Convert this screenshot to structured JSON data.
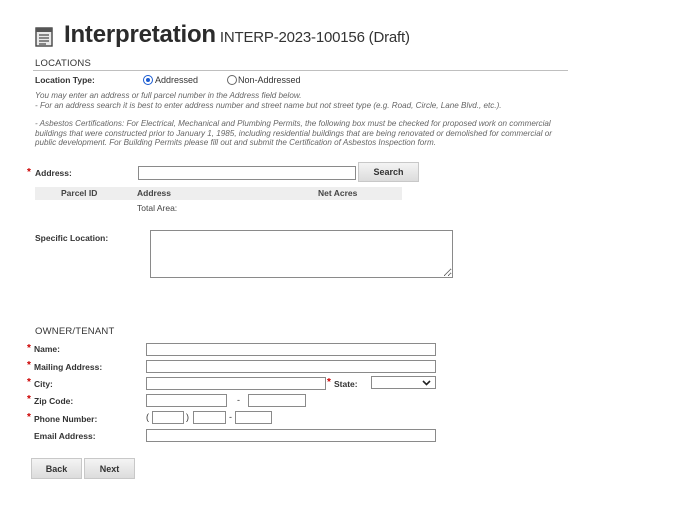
{
  "header": {
    "title": "Interpretation",
    "record": "INTERP-2023-100156 (Draft)"
  },
  "locations": {
    "section_title": "LOCATIONS",
    "location_type_label": "Location Type:",
    "options": [
      "Addressed",
      "Non-Addressed"
    ],
    "selected": "Addressed",
    "help_line1": "You may enter an address or full parcel number in the Address field below.",
    "help_line2": "- For an address search it is best to enter address number and street name but not street type (e.g. Road, Circle, Lane Blvd., etc.).",
    "help_asbestos": "- Asbestos Certifications: For Electrical, Mechanical and Plumbing Permits, the following box must be checked for proposed work on commercial buildings that were constructed prior to January 1, 1985, including residential buildings that are being renovated or demolished for commercial or public development. For Building Permits please fill out and submit the Certification of Asbestos Inspection form.",
    "address_label": "Address:",
    "address_value": "",
    "search_label": "Search",
    "table_headers": [
      "Parcel ID",
      "Address",
      "Net Acres"
    ],
    "total_area_label": "Total Area:",
    "specific_location_label": "Specific Location:"
  },
  "owner": {
    "section_title": "OWNER/TENANT",
    "name_label": "Name:",
    "mailing_label": "Mailing Address:",
    "city_label": "City:",
    "state_label": "State:",
    "state_value": "",
    "zip_label": "Zip Code:",
    "zip_sep": "-",
    "phone_label": "Phone Number:",
    "phone_open": "(",
    "phone_close": ")",
    "phone_sep": "-",
    "email_label": "Email Address:"
  },
  "actions": {
    "back_label": "Back",
    "next_label": "Next"
  },
  "colors": {
    "required": "#cc0000",
    "radio_selected": "#1a5bd1",
    "rule": "#bfbfbf"
  }
}
